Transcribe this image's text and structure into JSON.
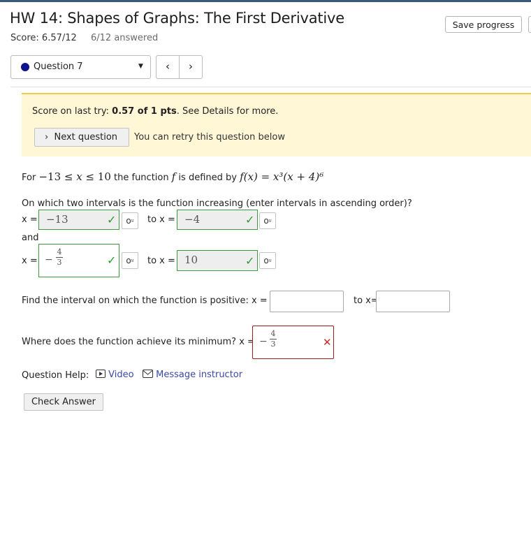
{
  "header": {
    "title": "HW 14: Shapes of Graphs: The First Derivative",
    "score": "Score: 6.57/12",
    "answered": "6/12 answered",
    "save_label": "Save progress"
  },
  "question_nav": {
    "selected": "Question 7",
    "prev_icon": "chevron-left-icon",
    "next_icon": "chevron-right-icon",
    "status_color": "#10148c"
  },
  "alert": {
    "prefix": "Score on last try: ",
    "score": "0.57 of 1 pts",
    "suffix": ". See Details for more.",
    "next_label": "Next question",
    "retry_text": "You can retry this question below"
  },
  "question": {
    "intro_for": "For",
    "intro_lower": "−13",
    "intro_ineq1": " ≤ ",
    "intro_var": "x",
    "intro_ineq2": " ≤ ",
    "intro_upper": "10",
    "intro_mid": " the function ",
    "intro_f": "f",
    "intro_defined": " is defined by ",
    "formula": "f(x) = x³(x + 4)⁶",
    "part1_prompt": "On which two intervals is the function increasing (enter intervals in ascending order)?",
    "x_label": "x =",
    "to_label": "to x =",
    "and_label": "and",
    "interval1_from": "−13",
    "interval1_to": "−4",
    "interval2_from_num": "4",
    "interval2_from_den": "3",
    "interval2_from_sign": "−",
    "interval2_to": "10",
    "part2_prompt": "Find the interval on which the function is positive: x =",
    "part2_to": "to x=",
    "part3_prompt": "Where does the function achieve its minimum? x =",
    "part3_sign": "−",
    "part3_num": "4",
    "part3_den": "3"
  },
  "help": {
    "label": "Question Help:",
    "video": "Video",
    "message": "Message instructor"
  },
  "check_label": "Check Answer"
}
